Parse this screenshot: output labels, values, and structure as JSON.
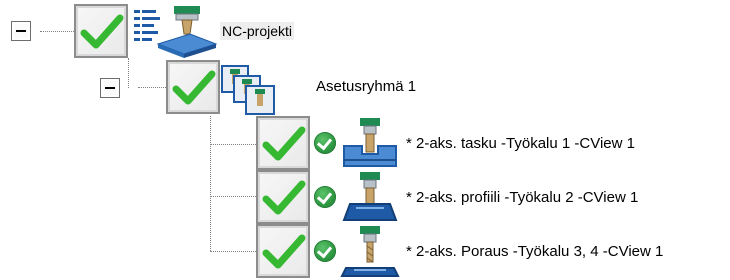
{
  "tree": {
    "root": {
      "label": "NC-projekti",
      "checked": true,
      "icon": "nc-machine-icon"
    },
    "group": {
      "label": "Asetusryhmä 1",
      "checked": true,
      "icon": "setup-group-icon"
    },
    "operations": [
      {
        "label": "* 2-aks. tasku -Työkalu 1 -CView 1",
        "checked": true,
        "status": "ok",
        "icon": "pocket-operation-icon"
      },
      {
        "label": "* 2-aks. profiili -Työkalu 2 -CView 1",
        "checked": true,
        "status": "ok",
        "icon": "contour-operation-icon"
      },
      {
        "label": "* 2-aks. Poraus -Työkalu 3, 4 -CView 1",
        "checked": true,
        "status": "ok",
        "icon": "drill-operation-icon"
      }
    ]
  },
  "colors": {
    "checkmark": "#36b832",
    "status_ok": "#2f9a43",
    "tool_green": "#1f8a52",
    "tool_body": "#b8c0c8",
    "fixture_blue": "#1e5aa6"
  }
}
